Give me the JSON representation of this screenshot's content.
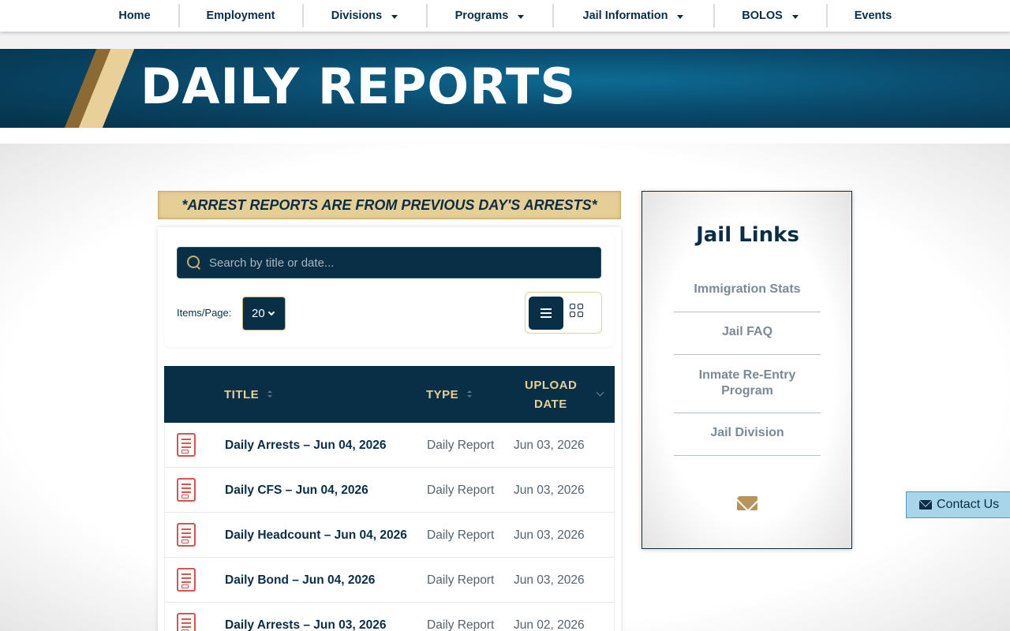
{
  "nav": {
    "items": [
      {
        "label": "Home"
      },
      {
        "label": "Employment"
      },
      {
        "label": "Divisions"
      },
      {
        "label": "Programs"
      },
      {
        "label": "Jail Information"
      },
      {
        "label": "BOLOS"
      },
      {
        "label": "Events"
      }
    ]
  },
  "banner": {
    "title": "DAILY REPORTS"
  },
  "notice": "*ARREST REPORTS ARE FROM PREVIOUS DAY'S ARRESTS*",
  "search": {
    "placeholder": "Search by title or date..."
  },
  "items_per_page": {
    "label": "Items/Page:",
    "value": "20"
  },
  "table": {
    "headers": {
      "title": "TITLE",
      "type": "TYPE",
      "upload_date_1": "UPLOAD",
      "upload_date_2": "DATE"
    },
    "rows": [
      {
        "title": "Daily Arrests – Jun 04, 2026",
        "type": "Daily Report",
        "date": "Jun 03, 2026"
      },
      {
        "title": "Daily CFS – Jun 04, 2026",
        "type": "Daily Report",
        "date": "Jun 03, 2026"
      },
      {
        "title": "Daily Headcount – Jun 04, 2026",
        "type": "Daily Report",
        "date": "Jun 03, 2026"
      },
      {
        "title": "Daily Bond – Jun 04, 2026",
        "type": "Daily Report",
        "date": "Jun 03, 2026"
      },
      {
        "title": "Daily Arrests – Jun 03, 2026",
        "type": "Daily Report",
        "date": "Jun 02, 2026"
      }
    ]
  },
  "sidebar": {
    "title": "Jail Links",
    "links": [
      {
        "label": "Immigration Stats"
      },
      {
        "label": "Jail FAQ"
      },
      {
        "label": "Inmate Re-Entry Program"
      },
      {
        "label": "Jail Division"
      }
    ]
  },
  "contact": {
    "label": "Contact Us"
  },
  "colors": {
    "navy": "#082f45",
    "gold": "#e6cf97",
    "accent_red": "#d9534f"
  }
}
